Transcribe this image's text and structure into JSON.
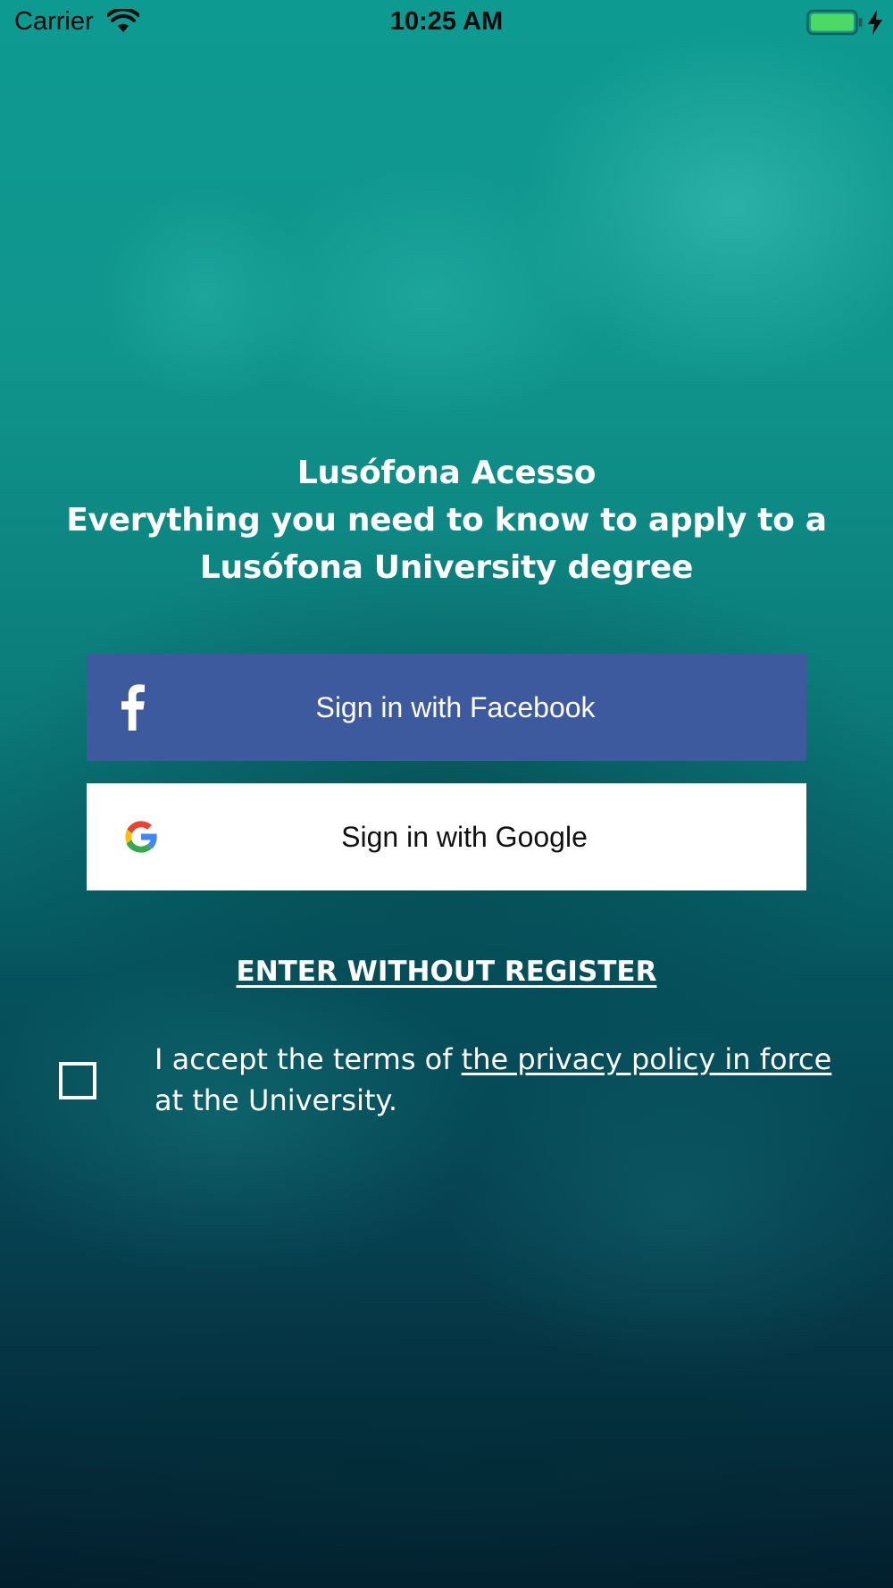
{
  "status_bar": {
    "carrier": "Carrier",
    "time": "10:25 AM",
    "wifi_icon": "wifi-icon",
    "battery_icon": "battery-icon",
    "charging_icon": "charging-bolt-icon",
    "battery_color": "#4cd964"
  },
  "headline": {
    "line1": "Lusófona Acesso",
    "line2": "Everything you need to know to apply to a",
    "line3": "Lusófona University degree"
  },
  "buttons": {
    "facebook": {
      "label": "Sign in with Facebook",
      "icon": "facebook-icon",
      "background": "#3d5a9e"
    },
    "google": {
      "label": "Sign in with Google",
      "icon": "google-icon",
      "background": "#ffffff"
    }
  },
  "guest_link": "ENTER WITHOUT REGISTER",
  "terms": {
    "checked": false,
    "prefix": "I accept the terms of ",
    "link": "the privacy policy in force",
    "suffix": " at the University."
  },
  "colors": {
    "background_top": "#0d9a91",
    "background_bottom": "#031e2d",
    "text": "#ffffff"
  }
}
